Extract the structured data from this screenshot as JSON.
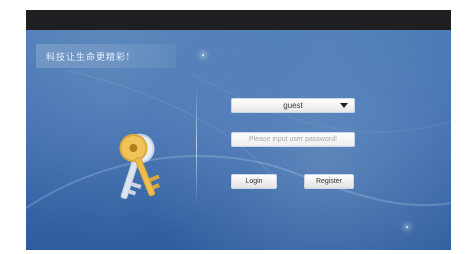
{
  "header": {
    "slogan": "科技让生命更精彩!"
  },
  "login": {
    "user_select": {
      "value": "guest"
    },
    "password": {
      "placeholder": "Please input user password!"
    },
    "buttons": {
      "login": "Login",
      "register": "Register"
    }
  },
  "icons": {
    "keys": "keys-icon",
    "dropdown": "chevron-down-icon"
  },
  "colors": {
    "background_top": "#4a7bb5",
    "background_bottom": "#2d5d9f",
    "topbar": "#1e1f22",
    "button_fill": "#e2e2e2"
  }
}
